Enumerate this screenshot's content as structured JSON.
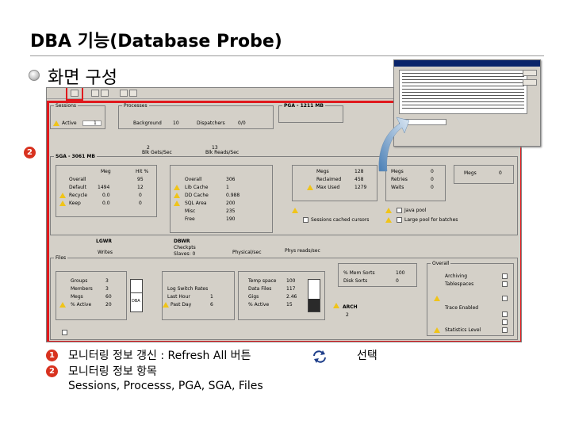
{
  "page": {
    "title": "DBA 기능(Database Probe)",
    "subtitle": "화면 구성"
  },
  "markers": [
    "1",
    "2"
  ],
  "screenshot": {
    "sessions": {
      "label": "Sessions",
      "rows": [
        {
          "label": "Active",
          "value": "1"
        }
      ]
    },
    "processes": {
      "label": "Processes",
      "rows": [
        {
          "label": "Background",
          "value": "10"
        },
        {
          "label": "Dispatchers",
          "value": "0/0"
        }
      ]
    },
    "pga": {
      "label": "PGA - 1211 MB"
    },
    "io": {
      "blk_gets": "Blk Gets/Sec",
      "blk_reads": "Blk Reads/Sec",
      "val1": "2",
      "val2": "13"
    },
    "sga": {
      "label": "SGA - 3061 MB",
      "buffer_cache": {
        "headers": [
          "Meg",
          "Hit %"
        ],
        "rows": [
          {
            "label": "Overall",
            "meg": "",
            "hit": "95"
          },
          {
            "label": "Default",
            "meg": "1494",
            "hit": "12"
          },
          {
            "label": "Recycle",
            "meg": "0.0",
            "hit": "0"
          },
          {
            "label": "Keep",
            "meg": "0.0",
            "hit": "0"
          }
        ]
      },
      "shared_pool": {
        "rows": [
          {
            "label": "Overall",
            "value": "306"
          },
          {
            "label": "Lib Cache",
            "value": "1"
          },
          {
            "label": "DD Cache",
            "value": "0.988"
          },
          {
            "label": "SQL Area",
            "value": "200"
          },
          {
            "label": "Misc",
            "value": "235"
          },
          {
            "label": "Free",
            "value": "190"
          }
        ]
      },
      "redo_log": {
        "rows": [
          {
            "label": "Megs",
            "value": "128"
          },
          {
            "label": "Reclaimed",
            "value": "458"
          },
          {
            "label": "Max Used",
            "value": "1279"
          }
        ]
      },
      "redo_buffer": {
        "rows": [
          {
            "label": "Megs",
            "value": "0"
          },
          {
            "label": "Retries",
            "value": "0"
          },
          {
            "label": "Waits",
            "value": "0"
          }
        ]
      },
      "large_pool": {
        "rows": [
          {
            "label": "Megs",
            "value": "0"
          }
        ]
      },
      "options": [
        {
          "label": "Sessions cached cursors"
        },
        {
          "label": "Java pool"
        },
        {
          "label": "Large pool for batches"
        }
      ]
    },
    "writers": {
      "lgwr": "LGWR",
      "lgwr_sub": "Writes",
      "dbwr": "DBWR",
      "dbwr_sub1": "Checkpts",
      "dbwr_sub2": "Slaves: 0",
      "phys_writes": "Physical/sec",
      "phys_reads": "Phys reads/sec"
    },
    "files": {
      "label": "Files",
      "datafiles": {
        "rows": [
          {
            "label": "Groups",
            "value": "3"
          },
          {
            "label": "Members",
            "value": "3"
          },
          {
            "label": "Megs",
            "value": "60"
          },
          {
            "label": "% Active",
            "value": "20"
          }
        ]
      },
      "log_switch": {
        "rows": [
          {
            "label": "Log Switch Rates",
            "value": ""
          },
          {
            "label": "Last Hour",
            "value": "1"
          },
          {
            "label": "Past Day",
            "value": "6"
          }
        ]
      },
      "control": {
        "rows": [
          {
            "label": "Temp space",
            "value": "100"
          },
          {
            "label": "Data Files",
            "value": "117"
          },
          {
            "label": "Gigs",
            "value": "2.46"
          },
          {
            "label": "% Active",
            "value": "15"
          }
        ]
      },
      "redo_bar_label": "DBA",
      "arch": "ARCH",
      "arch_value": "2",
      "bufs": {
        "rows": [
          {
            "label": "% Mem Sorts",
            "value": "100"
          },
          {
            "label": "Disk Sorts",
            "value": "0"
          }
        ]
      },
      "overall": {
        "label": "Overall",
        "rows": [
          {
            "label": "Archiving"
          },
          {
            "label": "Tablespaces"
          },
          {
            "label": "Trace Enabled"
          },
          {
            "label": "Statistics Level"
          }
        ]
      }
    }
  },
  "popup": {
    "title": ""
  },
  "footer": {
    "line1": "모니터링 정보 갱신 : Refresh All  버튼",
    "line1_tail": "선택",
    "line2": "모니터링 정보 항목",
    "line3": "Sessions, Processs, PGA, SGA, Files"
  }
}
